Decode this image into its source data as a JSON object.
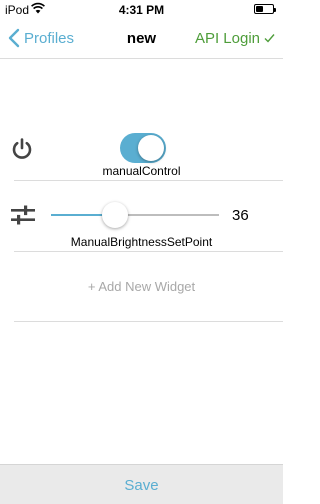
{
  "status_bar": {
    "carrier": "iPod",
    "time": "4:31 PM"
  },
  "nav": {
    "back_label": "Profiles",
    "title": "new",
    "api_login_label": "API Login"
  },
  "widgets": [
    {
      "type": "toggle",
      "icon": "power-icon",
      "label": "manualControl",
      "on": true
    },
    {
      "type": "slider",
      "icon": "sliders-icon",
      "label": "ManualBrightnessSetPoint",
      "value": "36",
      "fraction": 0.38
    }
  ],
  "add_widget_label": "+ Add New Widget",
  "save_label": "Save",
  "colors": {
    "accent": "#5aaed1",
    "success": "#4e9d3a",
    "icon": "#444444"
  }
}
